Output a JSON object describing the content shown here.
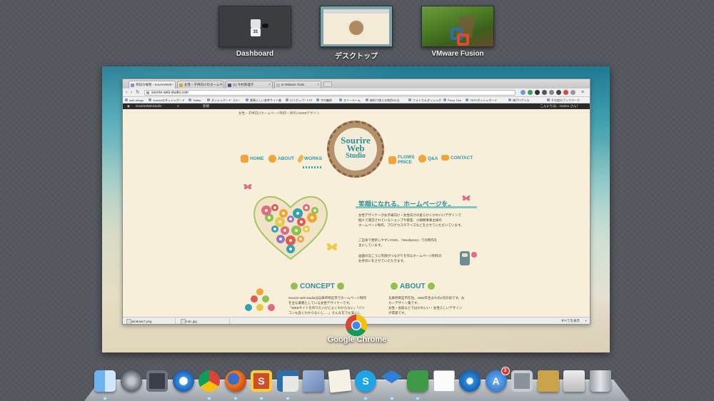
{
  "spaces": [
    {
      "label": "Dashboard"
    },
    {
      "label": "デスクトップ"
    },
    {
      "label": "VMware Fusion"
    }
  ],
  "dashboard_widget_text": "31",
  "chrome_window": {
    "app_label": "Google Chrome",
    "tabs": [
      {
        "title": "目指の複製 ‹ SourireWeb"
      },
      {
        "title": "女性・子供向けのホームペ"
      },
      {
        "title": "(1) 今村真理子"
      },
      {
        "title": "& VMware Tools"
      }
    ],
    "url": "sourire-web-studio.com",
    "bookmarks": [
      "web design",
      "Sourireのダッシュボード",
      "Twitter",
      "ダッシュボード（ロー",
      "素晴らしい参考サイト集",
      "ロリポップ！FTP",
      "今村義郎",
      "スリールーム",
      "無料で使える商用OKな",
      "フォトカムダッシュボ",
      "Press This",
      "TESTダッシュボード",
      "神戸ITクリエ",
      "その他のブックマーク"
    ],
    "admin_bar": {
      "site": "SourireWebStudio",
      "count": "4",
      "new": "新規",
      "greeting": "こんにちは、marieo さん！"
    },
    "site": {
      "tagline": "女性・子供向けホームページ制作・神奈川WEBデザイン",
      "nav": [
        "HOME",
        "ABOUT",
        "WORKS",
        "FLOWS PRICE",
        "Q&A",
        "CONTACT"
      ],
      "logo": {
        "line1": "Sourire",
        "line2": "Web",
        "line3": "Studio"
      },
      "heading": "笑顔になれる、ホームページを。",
      "intro": [
        "女性デザイナーがお子様向け・女性向けの柔らかくかわいいデザインで",
        "個人で運営されているショップや教室、小規模事業主様の",
        "ホームページ制作、ブログカスタマイズなどをさせていただいています。"
      ],
      "intro2": [
        "ご自身で更新しやすいCMS、『Wordpress』での制作を",
        "主にしています。"
      ],
      "intro3": [
        "画面の向こうに笑顔がつながりを作るホームページ制作の",
        "お手伝いをさせていただきます。"
      ],
      "concept_title": "CONCEPT",
      "concept_text": [
        "Sourire web studioは兵庫県明石市でホームページ制作",
        "を主な業務としている女性デザイナーです。",
        "「WEBサイトを作りたいけどよくわからない」「パソ",
        "コンも良くわからないし．．．」そんな方でも安心し"
      ],
      "about_title": "ABOUT",
      "about_text": [
        "兵庫県明石市在住。1982年生まれの2児の母です。お",
        "カーデザイン業です。",
        "女性・会館などではかわいい・女性らしいデザイン",
        "が得意です。"
      ]
    },
    "downloads": [
      "windows7.png",
      "mac.jpg"
    ],
    "downloads_link": "すべてを表示"
  },
  "dock": [
    {
      "name": "finder-icon"
    },
    {
      "name": "launchpad-icon"
    },
    {
      "name": "mission-control-icon"
    },
    {
      "name": "safari-icon"
    },
    {
      "name": "chrome-icon"
    },
    {
      "name": "firefox-icon"
    },
    {
      "name": "sublime-icon"
    },
    {
      "name": "vmware-icon"
    },
    {
      "name": "preview-icon"
    },
    {
      "name": "textedit-icon"
    },
    {
      "name": "skype-icon"
    },
    {
      "name": "dropbox-icon"
    },
    {
      "name": "evernote-icon"
    },
    {
      "name": "reminders-icon"
    },
    {
      "name": "itunes-icon"
    },
    {
      "name": "app-store-icon",
      "badge": "3"
    },
    {
      "name": "system-preferences-icon"
    },
    {
      "name": "transmit-icon"
    },
    {
      "name": "downloads-stack-icon"
    },
    {
      "name": "trash-icon"
    }
  ],
  "colors": {
    "accent": "#2f8f9b",
    "page_bg": "#f7efd9",
    "logo_brown": "#b5916b"
  }
}
